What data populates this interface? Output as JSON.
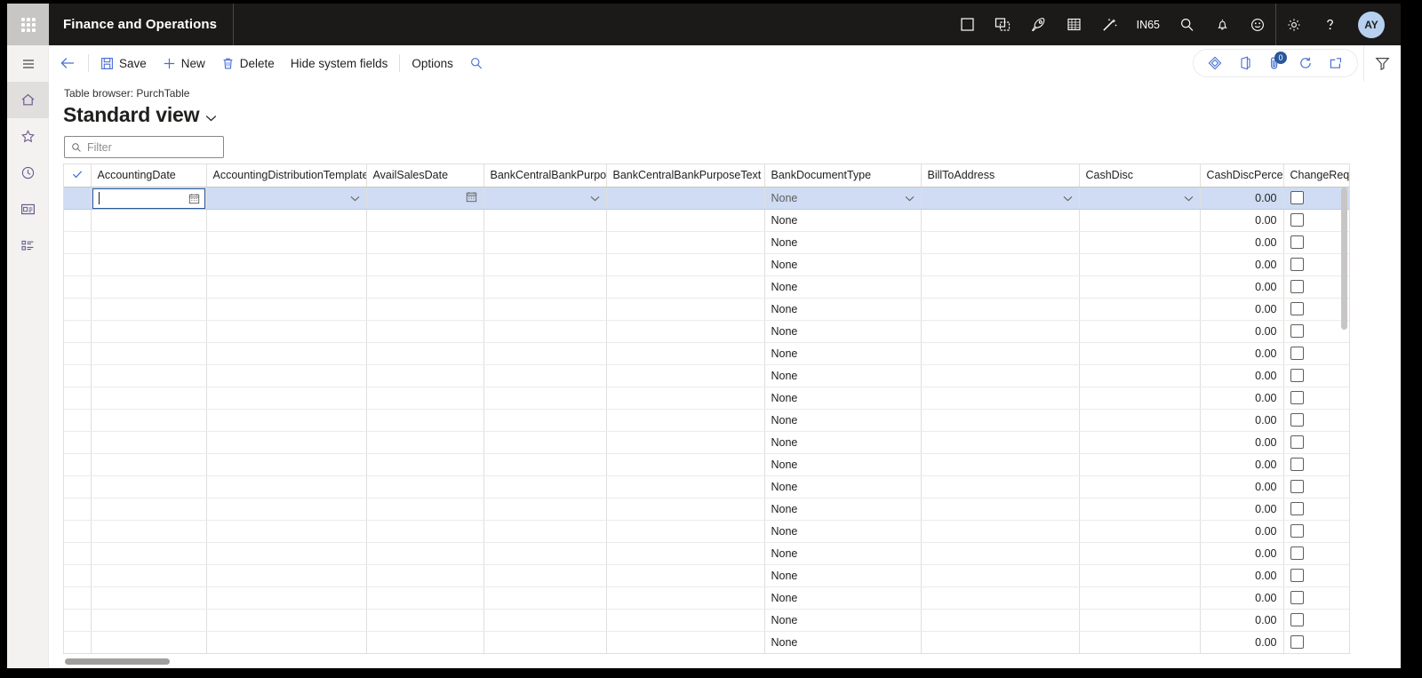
{
  "topbar": {
    "waffle_name": "app-launcher",
    "title": "Finance and Operations",
    "icons": [
      {
        "name": "window-icon",
        "label": ""
      },
      {
        "name": "copy-window-icon",
        "label": ""
      },
      {
        "name": "rocket-icon",
        "label": ""
      },
      {
        "name": "grid-table-icon",
        "label": ""
      },
      {
        "name": "magic-wand-icon",
        "label": ""
      }
    ],
    "company": "IN65",
    "right_icons": [
      {
        "name": "search-icon"
      },
      {
        "name": "notifications-bell-icon"
      },
      {
        "name": "feedback-smiley-icon"
      },
      {
        "name": "settings-gear-icon"
      },
      {
        "name": "help-question-icon"
      }
    ],
    "avatar_initials": "AY"
  },
  "rail": {
    "items": [
      {
        "name": "sidebar-item-menu",
        "icon": "hamburger-icon",
        "active": false
      },
      {
        "name": "sidebar-item-home",
        "icon": "home-icon",
        "active": true
      },
      {
        "name": "sidebar-item-favorites",
        "icon": "star-icon",
        "active": false
      },
      {
        "name": "sidebar-item-recent",
        "icon": "clock-icon",
        "active": false
      },
      {
        "name": "sidebar-item-workspaces",
        "icon": "workspace-card-icon",
        "active": false
      },
      {
        "name": "sidebar-item-modules",
        "icon": "list-icon",
        "active": false
      }
    ]
  },
  "commandbar": {
    "back_label": "",
    "save_label": "Save",
    "new_label": "New",
    "delete_label": "Delete",
    "hide_system_fields_label": "Hide system fields",
    "options_label": "Options",
    "search_label": "",
    "right": {
      "share_icon": "share-diamond-icon",
      "office_icon": "office-app-icon",
      "attachments_icon": "attachments-icon",
      "attachments_badge": "0",
      "refresh_icon": "refresh-icon",
      "popout_icon": "open-in-new-window-icon"
    },
    "filter_pane_icon": "filter-funnel-icon"
  },
  "page": {
    "breadcrumb": "Table browser: PurchTable",
    "view_title": "Standard view",
    "filter": {
      "placeholder": "Filter",
      "value": ""
    }
  },
  "grid": {
    "columns": [
      {
        "key": "check",
        "label": ""
      },
      {
        "key": "AccountingDate",
        "label": "AccountingDate"
      },
      {
        "key": "AccountingDistributionTemplate",
        "label": "AccountingDistributionTemplate"
      },
      {
        "key": "AvailSalesDate",
        "label": "AvailSalesDate"
      },
      {
        "key": "BankCentralBankPurpose",
        "label": "BankCentralBankPurpose..."
      },
      {
        "key": "BankCentralBankPurposeText",
        "label": "BankCentralBankPurposeText"
      },
      {
        "key": "BankDocumentType",
        "label": "BankDocumentType"
      },
      {
        "key": "BillToAddress",
        "label": "BillToAddress"
      },
      {
        "key": "CashDisc",
        "label": "CashDisc"
      },
      {
        "key": "CashDiscPercent",
        "label": "CashDiscPercent"
      },
      {
        "key": "ChangeRequest",
        "label": "ChangeReques"
      }
    ],
    "selected_row_index": 0,
    "selected_row": {
      "AccountingDate": "",
      "AccountingDistributionTemplate": "",
      "AvailSalesDate": "",
      "BankCentralBankPurpose": "",
      "BankCentralBankPurposeText": "",
      "BankDocumentType": "None",
      "BillToAddress": "",
      "CashDisc": "",
      "CashDiscPercent": "0.00",
      "ChangeRequest": false
    },
    "rows": [
      {
        "BankDocumentType": "None",
        "CashDiscPercent": "0.00",
        "ChangeRequest": false
      },
      {
        "BankDocumentType": "None",
        "CashDiscPercent": "0.00",
        "ChangeRequest": false
      },
      {
        "BankDocumentType": "None",
        "CashDiscPercent": "0.00",
        "ChangeRequest": false
      },
      {
        "BankDocumentType": "None",
        "CashDiscPercent": "0.00",
        "ChangeRequest": false
      },
      {
        "BankDocumentType": "None",
        "CashDiscPercent": "0.00",
        "ChangeRequest": false
      },
      {
        "BankDocumentType": "None",
        "CashDiscPercent": "0.00",
        "ChangeRequest": false
      },
      {
        "BankDocumentType": "None",
        "CashDiscPercent": "0.00",
        "ChangeRequest": false
      },
      {
        "BankDocumentType": "None",
        "CashDiscPercent": "0.00",
        "ChangeRequest": false
      },
      {
        "BankDocumentType": "None",
        "CashDiscPercent": "0.00",
        "ChangeRequest": false
      },
      {
        "BankDocumentType": "None",
        "CashDiscPercent": "0.00",
        "ChangeRequest": false
      },
      {
        "BankDocumentType": "None",
        "CashDiscPercent": "0.00",
        "ChangeRequest": false
      },
      {
        "BankDocumentType": "None",
        "CashDiscPercent": "0.00",
        "ChangeRequest": false
      },
      {
        "BankDocumentType": "None",
        "CashDiscPercent": "0.00",
        "ChangeRequest": false
      },
      {
        "BankDocumentType": "None",
        "CashDiscPercent": "0.00",
        "ChangeRequest": false
      },
      {
        "BankDocumentType": "None",
        "CashDiscPercent": "0.00",
        "ChangeRequest": false
      },
      {
        "BankDocumentType": "None",
        "CashDiscPercent": "0.00",
        "ChangeRequest": false
      },
      {
        "BankDocumentType": "None",
        "CashDiscPercent": "0.00",
        "ChangeRequest": false
      },
      {
        "BankDocumentType": "None",
        "CashDiscPercent": "0.00",
        "ChangeRequest": false
      },
      {
        "BankDocumentType": "None",
        "CashDiscPercent": "0.00",
        "ChangeRequest": false
      },
      {
        "BankDocumentType": "None",
        "CashDiscPercent": "0.00",
        "ChangeRequest": false
      }
    ]
  },
  "colors": {
    "topbar_bg": "#1b1a19",
    "accent": "#2b579a",
    "selected_row": "#cfdcf3",
    "avatar_bg": "#b7d0ef",
    "rail_bg": "#f3f2f1"
  }
}
